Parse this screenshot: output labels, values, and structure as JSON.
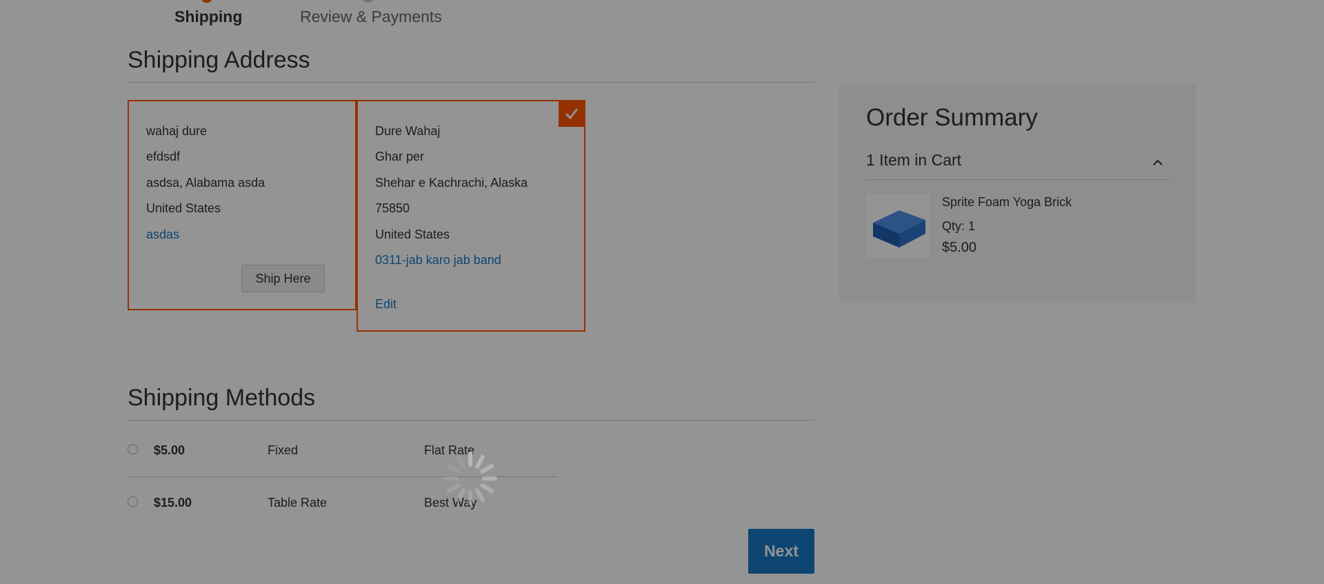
{
  "progress": {
    "steps": [
      {
        "label": "Shipping",
        "active": true
      },
      {
        "label": "Review & Payments",
        "active": false
      }
    ]
  },
  "shipping_address": {
    "title": "Shipping Address",
    "cards": [
      {
        "lines": [
          "wahaj dure",
          "efdsdf",
          "asdsa, Alabama asda",
          "United States"
        ],
        "phone": "asdas",
        "button": "Ship Here",
        "selected": false
      },
      {
        "lines": [
          "Dure Wahaj",
          "Ghar per",
          "Shehar e Kachrachi, Alaska",
          "75850",
          "United States"
        ],
        "phone": "0311-jab karo jab band",
        "edit": "Edit",
        "selected": true
      }
    ]
  },
  "order_summary": {
    "title": "Order Summary",
    "items_label": "1 Item in Cart",
    "product": {
      "name": "Sprite Foam Yoga Brick",
      "qty": "Qty: 1",
      "price": "$5.00"
    }
  },
  "shipping_methods": {
    "title": "Shipping Methods",
    "rows": [
      {
        "price": "$5.00",
        "method": "Fixed",
        "carrier": "Flat Rate"
      },
      {
        "price": "$15.00",
        "method": "Table Rate",
        "carrier": "Best Way"
      }
    ]
  },
  "next_button": "Next",
  "colors": {
    "accent": "#ff5501",
    "link": "#1979c3",
    "overlay": "rgba(0,0,0,0.42)"
  }
}
